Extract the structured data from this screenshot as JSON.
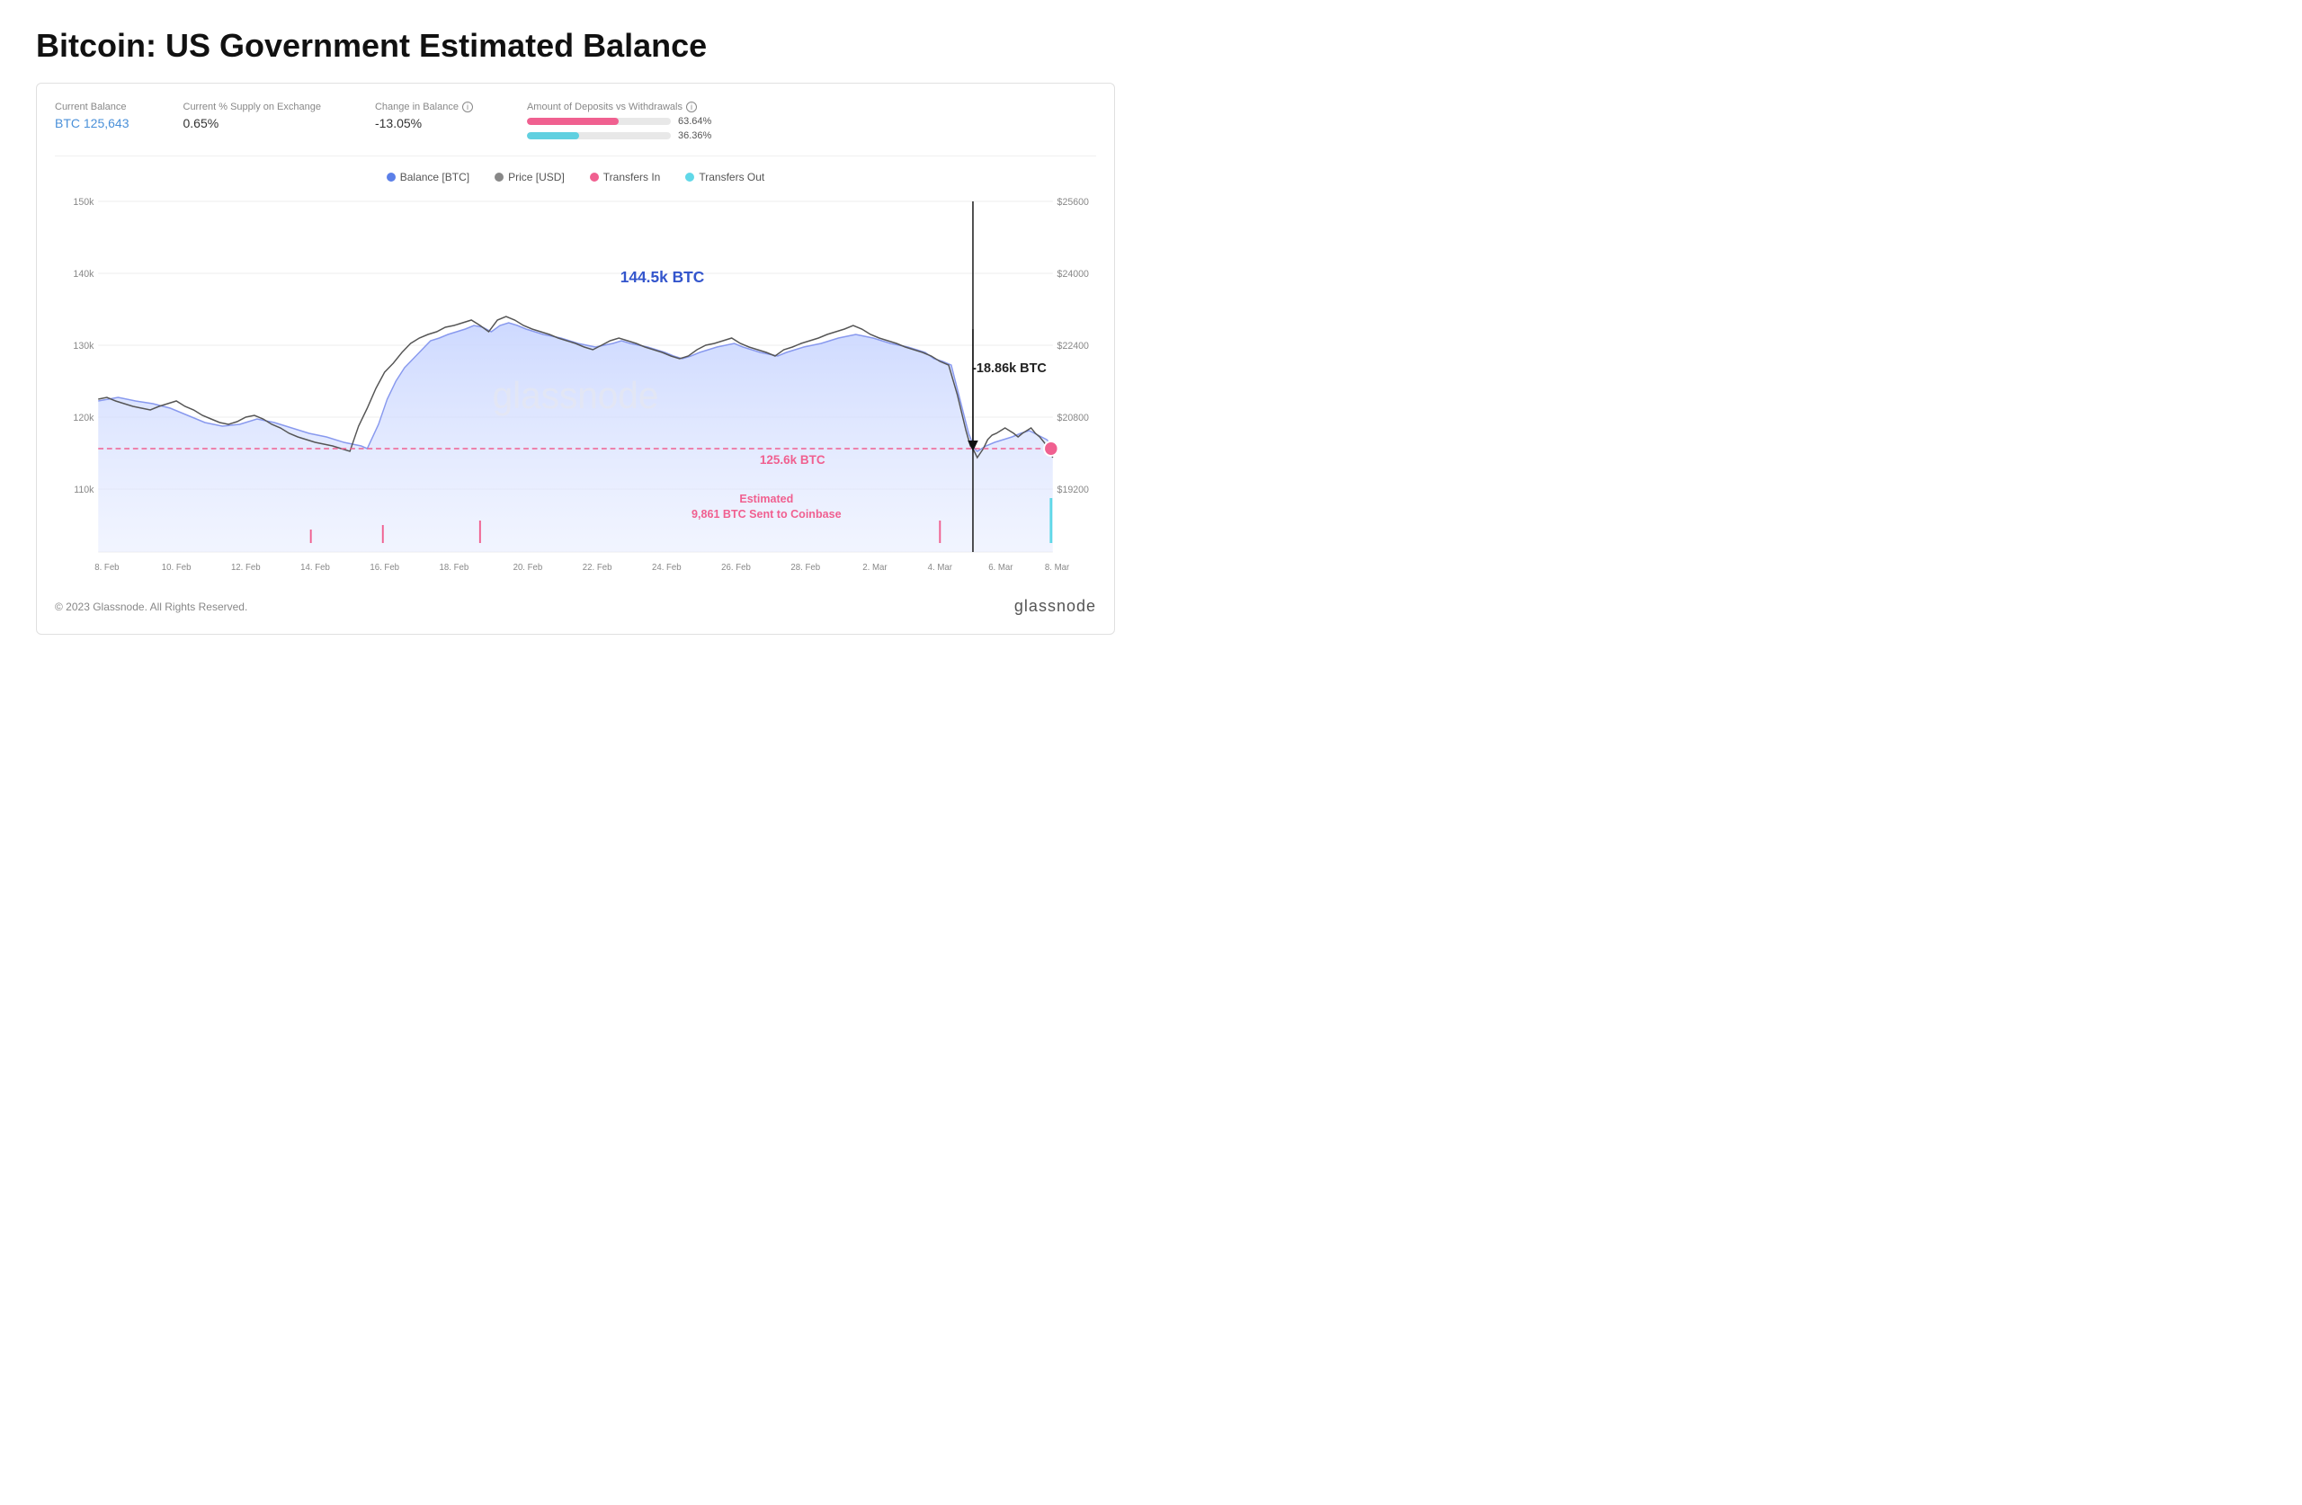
{
  "page": {
    "title": "Bitcoin: US Government Estimated Balance"
  },
  "stats": {
    "current_balance_label": "Current Balance",
    "current_balance_value": "BTC 125,643",
    "supply_label": "Current % Supply on Exchange",
    "supply_value": "0.65%",
    "change_label": "Change in Balance",
    "change_value": "-13.05%",
    "deposits_label": "Amount of Deposits vs Withdrawals",
    "deposits_pct1": "63.64%",
    "deposits_pct2": "36.36%"
  },
  "legend": {
    "balance_label": "Balance [BTC]",
    "price_label": "Price [USD]",
    "transfers_in_label": "Transfers In",
    "transfers_out_label": "Transfers Out"
  },
  "chart": {
    "annotations": {
      "peak_label": "144.5k BTC",
      "drop_label": "-18.86k BTC",
      "current_label": "125.6k BTC",
      "coinbase_label": "Estimated\n9,861 BTC Sent to Coinbase"
    },
    "y_left": [
      "150k",
      "140k",
      "130k",
      "120k",
      "110k"
    ],
    "y_right": [
      "$25600",
      "$24000",
      "$22400",
      "$20800",
      "$19200"
    ],
    "x_labels": [
      "8. Feb",
      "10. Feb",
      "12. Feb",
      "14. Feb",
      "16. Feb",
      "18. Feb",
      "20. Feb",
      "22. Feb",
      "24. Feb",
      "26. Feb",
      "28. Feb",
      "2. Mar",
      "4. Mar",
      "6. Mar",
      "8. Mar"
    ]
  },
  "footer": {
    "copyright": "© 2023 Glassnode. All Rights Reserved.",
    "logo": "glassnode"
  },
  "colors": {
    "balance_dot": "#5b7fe8",
    "price_dot": "#888888",
    "transfers_in_dot": "#f06090",
    "transfers_out_dot": "#60d8e8",
    "area_fill": "#dde5ff",
    "area_stroke": "#8899ee"
  }
}
